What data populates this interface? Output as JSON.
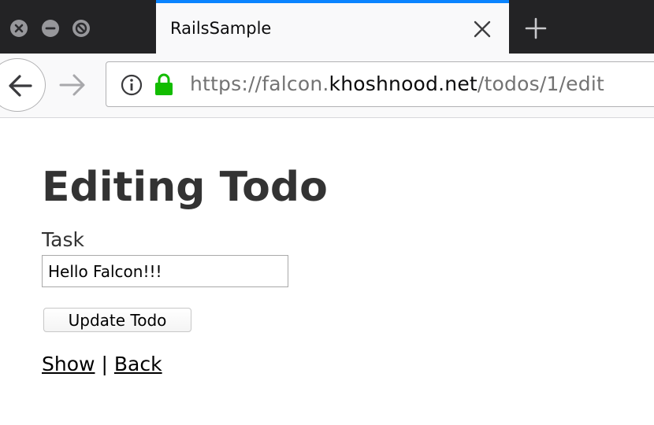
{
  "browser": {
    "tab": {
      "title": "RailsSample"
    },
    "url": {
      "scheme": "https://",
      "subdomain": "falcon.",
      "domain": "khoshnood.net",
      "path": "/todos/1/edit"
    },
    "accent_color": "#0a84ff",
    "lock_color": "#12bc00"
  },
  "page": {
    "title": "Editing Todo",
    "form": {
      "task_label": "Task",
      "task_value": "Hello Falcon!!!",
      "submit_label": "Update Todo"
    },
    "links": {
      "show": "Show",
      "separator": "|",
      "back": "Back"
    }
  },
  "icons": {
    "window_close": "close-window-icon",
    "window_minimize": "minimize-window-icon",
    "window_maximize": "maximize-window-icon",
    "tab_close": "close-icon",
    "new_tab": "plus-icon",
    "back": "arrow-left-icon",
    "forward": "arrow-right-icon",
    "info": "info-icon",
    "lock": "lock-icon"
  }
}
